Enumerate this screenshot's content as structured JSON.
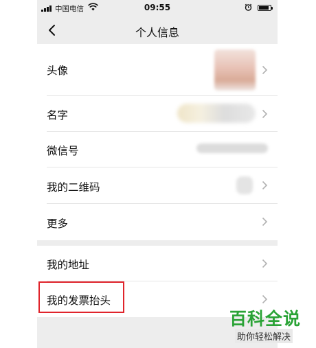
{
  "status_bar": {
    "carrier": "中国电信",
    "time": "09:55",
    "battery_level": 0.9
  },
  "navbar": {
    "title": "个人信息",
    "back_icon": "chevron-left-icon"
  },
  "profile_group": [
    {
      "label": "头像",
      "value_type": "avatar-image"
    },
    {
      "label": "名字",
      "value_type": "blurred-text"
    },
    {
      "label": "微信号",
      "value_type": "blurred-text"
    },
    {
      "label": "我的二维码",
      "value_type": "qr-icon"
    },
    {
      "label": "更多"
    }
  ],
  "extra_group": [
    {
      "label": "我的地址"
    },
    {
      "label": "我的发票抬头",
      "highlighted": true,
      "highlight_color": "#e0242b"
    }
  ],
  "icons": {
    "row_chevron": "chevron-right-icon"
  },
  "watermark": {
    "title": "百科全说",
    "subtitle": "助你轻松解决",
    "color": "#2aa336"
  }
}
